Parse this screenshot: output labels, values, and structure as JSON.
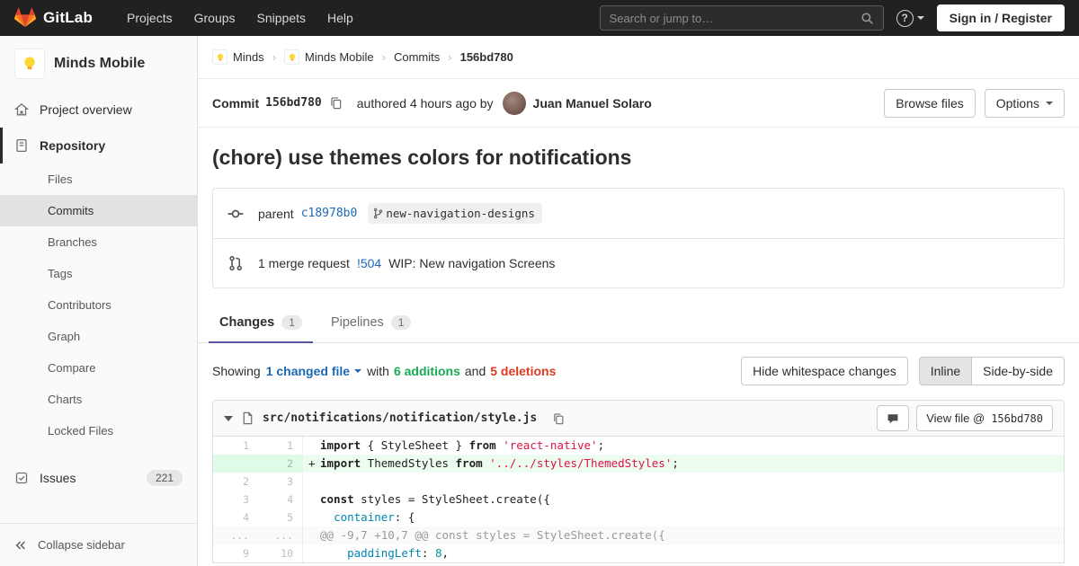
{
  "navbar": {
    "brand": "GitLab",
    "menu": [
      "Projects",
      "Groups",
      "Snippets",
      "Help"
    ],
    "search_placeholder": "Search or jump to…",
    "sign_in": "Sign in / Register"
  },
  "sidebar": {
    "project_name": "Minds Mobile",
    "overview_label": "Project overview",
    "repository_label": "Repository",
    "subitems": [
      {
        "label": "Files",
        "active": false
      },
      {
        "label": "Commits",
        "active": true
      },
      {
        "label": "Branches",
        "active": false
      },
      {
        "label": "Tags",
        "active": false
      },
      {
        "label": "Contributors",
        "active": false
      },
      {
        "label": "Graph",
        "active": false
      },
      {
        "label": "Compare",
        "active": false
      },
      {
        "label": "Charts",
        "active": false
      },
      {
        "label": "Locked Files",
        "active": false
      }
    ],
    "issues_label": "Issues",
    "issues_count": "221",
    "collapse_label": "Collapse sidebar"
  },
  "breadcrumb": {
    "items": [
      {
        "label": "Minds",
        "avatar": true
      },
      {
        "label": "Minds Mobile",
        "avatar": true
      },
      {
        "label": "Commits",
        "avatar": false
      }
    ],
    "current": "156bd780"
  },
  "commit": {
    "label": "Commit",
    "sha": "156bd780",
    "authored_text": "authored 4 hours ago by",
    "author": "Juan Manuel Solaro",
    "browse_files_label": "Browse files",
    "options_label": "Options",
    "title": "(chore) use themes colors for notifications",
    "parent_label": "parent",
    "parent_sha": "c18978b0",
    "branch_name": "new-navigation-designs",
    "mr_prefix": "1 merge request",
    "mr_id": "!504",
    "mr_title": "WIP: New navigation Screens"
  },
  "tabs": [
    {
      "label": "Changes",
      "count": "1",
      "active": true
    },
    {
      "label": "Pipelines",
      "count": "1",
      "active": false
    }
  ],
  "summary": {
    "showing": "Showing",
    "changed": "1 changed file",
    "with_word": "with",
    "additions": "6 additions",
    "and_word": "and",
    "deletions": "5 deletions",
    "hide_whitespace": "Hide whitespace changes",
    "inline": "Inline",
    "side_by_side": "Side-by-side"
  },
  "diff": {
    "file_path": "src/notifications/notification/style.js",
    "view_file_prefix": "View file @",
    "view_file_sha": "156bd780",
    "lines": [
      {
        "type": "normal",
        "old": "1",
        "new": "1",
        "segments": [
          {
            "t": "import",
            "c": "k"
          },
          {
            "t": " { StyleSheet } ",
            "c": ""
          },
          {
            "t": "from",
            "c": "k"
          },
          {
            "t": " ",
            "c": ""
          },
          {
            "t": "'react-native'",
            "c": "s"
          },
          {
            "t": ";",
            "c": ""
          }
        ]
      },
      {
        "type": "add",
        "old": "",
        "new": "2",
        "segments": [
          {
            "t": "import",
            "c": "k"
          },
          {
            "t": " ThemedStyles ",
            "c": ""
          },
          {
            "t": "from",
            "c": "k"
          },
          {
            "t": " ",
            "c": ""
          },
          {
            "t": "'../../styles/ThemedStyles'",
            "c": "s"
          },
          {
            "t": ";",
            "c": ""
          }
        ]
      },
      {
        "type": "normal",
        "old": "2",
        "new": "3",
        "segments": []
      },
      {
        "type": "normal",
        "old": "3",
        "new": "4",
        "segments": [
          {
            "t": "const",
            "c": "k"
          },
          {
            "t": " styles = StyleSheet.create({",
            "c": ""
          }
        ]
      },
      {
        "type": "normal",
        "old": "4",
        "new": "5",
        "segments": [
          {
            "t": "  ",
            "c": ""
          },
          {
            "t": "container",
            "c": "pr"
          },
          {
            "t": ": {",
            "c": ""
          }
        ]
      },
      {
        "type": "match",
        "old": "...",
        "new": "...",
        "segments": [
          {
            "t": "@@ -9,7 +10,7 @@ const styles = StyleSheet.create({",
            "c": ""
          }
        ]
      },
      {
        "type": "normal",
        "old": "9",
        "new": "10",
        "segments": [
          {
            "t": "    ",
            "c": ""
          },
          {
            "t": "paddingLeft",
            "c": "pr"
          },
          {
            "t": ": ",
            "c": ""
          },
          {
            "t": "8",
            "c": "n"
          },
          {
            "t": ",",
            "c": ""
          }
        ]
      }
    ]
  },
  "colors": {
    "navbar_bg": "#212121",
    "link": "#1b69b6",
    "addition_green": "#1aaa55",
    "deletion_red": "#db3b21",
    "added_line_bg": "#ecfdf0",
    "tab_indicator": "#56569e",
    "brand_orange": "#e24329"
  }
}
